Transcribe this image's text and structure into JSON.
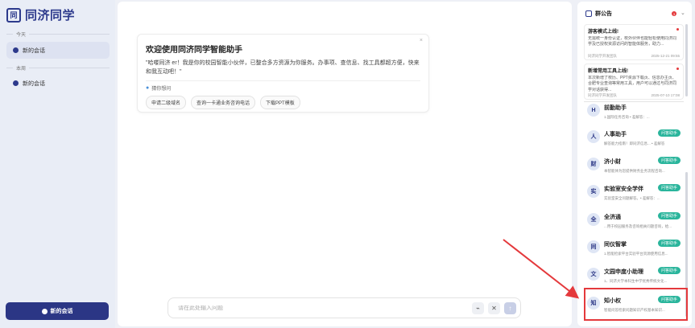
{
  "app": {
    "title": "同济同学",
    "logo_glyph": "同"
  },
  "sidebar": {
    "groups": [
      {
        "label": "今天",
        "item": "新的会话"
      },
      {
        "label": "本周",
        "item": "新的会话"
      }
    ],
    "new_chat_label": "新的会话"
  },
  "welcome": {
    "title": "欢迎使用同济同学智能助手",
    "desc": "\"哈喽同济 er！我是你的校园智能小伙伴，已整合多方资源为你服务。办事项、查信息、找工具都超方便，快来和我互动吧！\"",
    "guess_label": "猜你想问",
    "chips": [
      "申请二级域名",
      "查询一卡通业务咨询电话",
      "下载PPT模板"
    ],
    "close": "×"
  },
  "input": {
    "placeholder": "请在此处输入问题",
    "attach_icon": "paperclip-icon",
    "clear_icon": "close-icon",
    "send_icon": "send-arrow-icon"
  },
  "notice": {
    "title": "群公告",
    "count": "3",
    "items": [
      {
        "title": "游客模式上线!",
        "body": "无需统一身份认证，校外伙伴也能轻松使用同济同学及已授权资源访问的智能体服务，助力...",
        "source": "同济同学开发团队",
        "date": "2025-12-21 09:55"
      },
      {
        "title": "新增常用工具上线!",
        "body": "本次新增了校历、PPT资源下载页、信息办主页、合肥专业查询等常用工具，用户可以通过与同济同学对话获得...",
        "source": "同济同学开发团队",
        "date": "2025-07-10 17:08"
      }
    ]
  },
  "agents": [
    {
      "name": "前勤助手",
      "desc": "1.国际任务咨询  • 差解答：...",
      "tag": "",
      "logo": "H"
    },
    {
      "name": "人事助手",
      "desc": "解答能力指南！即同济信息...  • 差解答",
      "tag": "问答助手",
      "logo": "人"
    },
    {
      "name": "济小财",
      "desc": "本智能体为您提供财务业务流程咨询...",
      "tag": "问答助手",
      "logo": "财"
    },
    {
      "name": "实验室安全学伴",
      "desc": "实验室安全问题解答。• 差解答：...",
      "tag": "问答助手",
      "logo": "实"
    },
    {
      "name": "全济通",
      "desc": "...用于校园服务及咨询相关问题咨询，给...",
      "tag": "问答助手",
      "logo": "全"
    },
    {
      "name": "同仪智掌",
      "desc": "1.智能检索平台实验平台资源使用信息...",
      "tag": "问答助手",
      "logo": "同"
    },
    {
      "name": "文园申度小助理",
      "desc": "1、同济大学本科生中学优秀传统文化...",
      "tag": "问答助手",
      "logo": "文"
    },
    {
      "name": "知小权",
      "desc": "智能问答检索问题知识产权基本知识...",
      "tag": "问答助手",
      "logo": "知"
    }
  ],
  "colors": {
    "brand": "#2b3685",
    "tag": "#2ab59c",
    "highlight": "#e4393c"
  }
}
